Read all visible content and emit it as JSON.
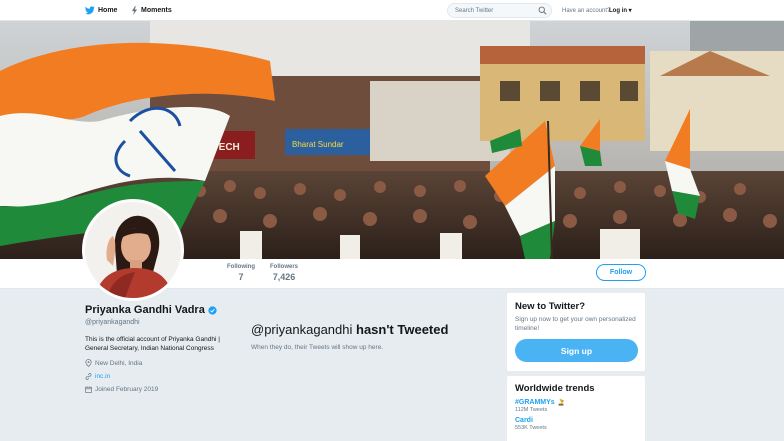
{
  "nav": {
    "home_label": "Home",
    "moments_label": "Moments",
    "search_placeholder": "Search Twitter",
    "have_account": "Have an account?",
    "login_label": "Log in ▾"
  },
  "colors": {
    "accent": "#1da1f2",
    "signup": "#4ab3f4",
    "background": "#e6ecf0",
    "flag_saffron": "#f27c22",
    "flag_green": "#1f8a3a"
  },
  "profile": {
    "name": "Priyanka Gandhi Vadra",
    "handle": "@priyankagandhi",
    "bio": "This is the official account of Priyanka Gandhi | General Secretary, Indian National Congress",
    "location": "New Delhi, India",
    "website": "inc.in",
    "joined": "Joined February 2019",
    "verified": true
  },
  "stats": {
    "following_label": "Following",
    "following_value": "7",
    "followers_label": "Followers",
    "followers_value": "7,426",
    "follow_button": "Follow"
  },
  "timeline": {
    "handle": "@priyankagandhi",
    "message": "hasn't Tweeted",
    "sub": "When they do, their Tweets will show up here."
  },
  "signup_card": {
    "title": "New to Twitter?",
    "text": "Sign up now to get your own personalized timeline!",
    "button": "Sign up"
  },
  "trends": {
    "title": "Worldwide trends",
    "items": [
      {
        "name": "#GRAMMYs",
        "count": "112M Tweets"
      },
      {
        "name": "Cardi",
        "count": "553K Tweets"
      }
    ]
  },
  "banner": {
    "signs": [
      "HI BIOTECH",
      "Bharat Sundar"
    ]
  }
}
